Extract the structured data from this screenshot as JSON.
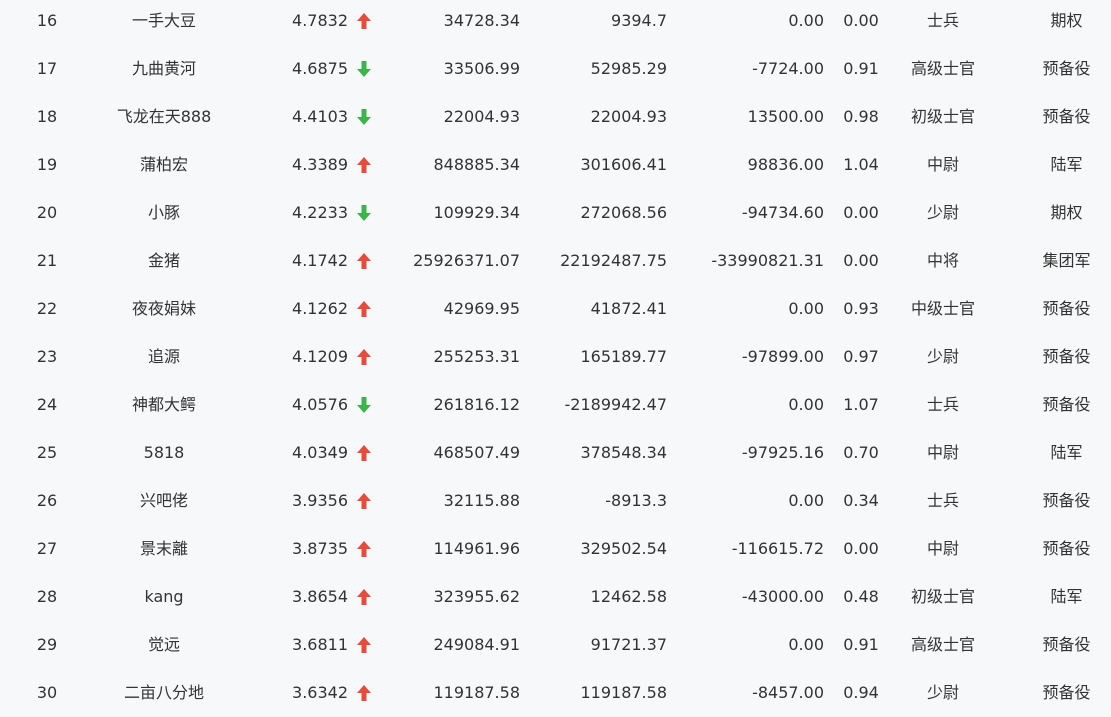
{
  "colors": {
    "background": "#f7f8fa",
    "text": "#333333",
    "up": "#e64b3c",
    "down": "#3bb54a"
  },
  "rows": [
    {
      "rank": "16",
      "name": "一手大豆",
      "score": "4.7832",
      "trend": "up",
      "col_a": "34728.34",
      "col_b": "9394.7",
      "col_c": "0.00",
      "col_d": "0.00",
      "rank_title": "士兵",
      "branch": "期权"
    },
    {
      "rank": "17",
      "name": "九曲黄河",
      "score": "4.6875",
      "trend": "down",
      "col_a": "33506.99",
      "col_b": "52985.29",
      "col_c": "-7724.00",
      "col_d": "0.91",
      "rank_title": "高级士官",
      "branch": "预备役"
    },
    {
      "rank": "18",
      "name": "飞龙在天888",
      "score": "4.4103",
      "trend": "down",
      "col_a": "22004.93",
      "col_b": "22004.93",
      "col_c": "13500.00",
      "col_d": "0.98",
      "rank_title": "初级士官",
      "branch": "预备役"
    },
    {
      "rank": "19",
      "name": "蒲柏宏",
      "score": "4.3389",
      "trend": "up",
      "col_a": "848885.34",
      "col_b": "301606.41",
      "col_c": "98836.00",
      "col_d": "1.04",
      "rank_title": "中尉",
      "branch": "陆军"
    },
    {
      "rank": "20",
      "name": "小豚",
      "score": "4.2233",
      "trend": "down",
      "col_a": "109929.34",
      "col_b": "272068.56",
      "col_c": "-94734.60",
      "col_d": "0.00",
      "rank_title": "少尉",
      "branch": "期权"
    },
    {
      "rank": "21",
      "name": "金猪",
      "score": "4.1742",
      "trend": "up",
      "col_a": "25926371.07",
      "col_b": "22192487.75",
      "col_c": "-33990821.31",
      "col_d": "0.00",
      "rank_title": "中将",
      "branch": "集团军"
    },
    {
      "rank": "22",
      "name": "夜夜娟妹",
      "score": "4.1262",
      "trend": "up",
      "col_a": "42969.95",
      "col_b": "41872.41",
      "col_c": "0.00",
      "col_d": "0.93",
      "rank_title": "中级士官",
      "branch": "预备役"
    },
    {
      "rank": "23",
      "name": "追源",
      "score": "4.1209",
      "trend": "up",
      "col_a": "255253.31",
      "col_b": "165189.77",
      "col_c": "-97899.00",
      "col_d": "0.97",
      "rank_title": "少尉",
      "branch": "预备役"
    },
    {
      "rank": "24",
      "name": "神都大鳄",
      "score": "4.0576",
      "trend": "down",
      "col_a": "261816.12",
      "col_b": "-2189942.47",
      "col_c": "0.00",
      "col_d": "1.07",
      "rank_title": "士兵",
      "branch": "预备役"
    },
    {
      "rank": "25",
      "name": "5818",
      "score": "4.0349",
      "trend": "up",
      "col_a": "468507.49",
      "col_b": "378548.34",
      "col_c": "-97925.16",
      "col_d": "0.70",
      "rank_title": "中尉",
      "branch": "陆军"
    },
    {
      "rank": "26",
      "name": "兴吧佬",
      "score": "3.9356",
      "trend": "up",
      "col_a": "32115.88",
      "col_b": "-8913.3",
      "col_c": "0.00",
      "col_d": "0.34",
      "rank_title": "士兵",
      "branch": "预备役"
    },
    {
      "rank": "27",
      "name": "景末離",
      "score": "3.8735",
      "trend": "up",
      "col_a": "114961.96",
      "col_b": "329502.54",
      "col_c": "-116615.72",
      "col_d": "0.00",
      "rank_title": "中尉",
      "branch": "预备役"
    },
    {
      "rank": "28",
      "name": "kang",
      "score": "3.8654",
      "trend": "up",
      "col_a": "323955.62",
      "col_b": "12462.58",
      "col_c": "-43000.00",
      "col_d": "0.48",
      "rank_title": "初级士官",
      "branch": "陆军"
    },
    {
      "rank": "29",
      "name": "觉远",
      "score": "3.6811",
      "trend": "up",
      "col_a": "249084.91",
      "col_b": "91721.37",
      "col_c": "0.00",
      "col_d": "0.91",
      "rank_title": "高级士官",
      "branch": "预备役"
    },
    {
      "rank": "30",
      "name": "二亩八分地",
      "score": "3.6342",
      "trend": "up",
      "col_a": "119187.58",
      "col_b": "119187.58",
      "col_c": "-8457.00",
      "col_d": "0.94",
      "rank_title": "少尉",
      "branch": "预备役"
    }
  ]
}
